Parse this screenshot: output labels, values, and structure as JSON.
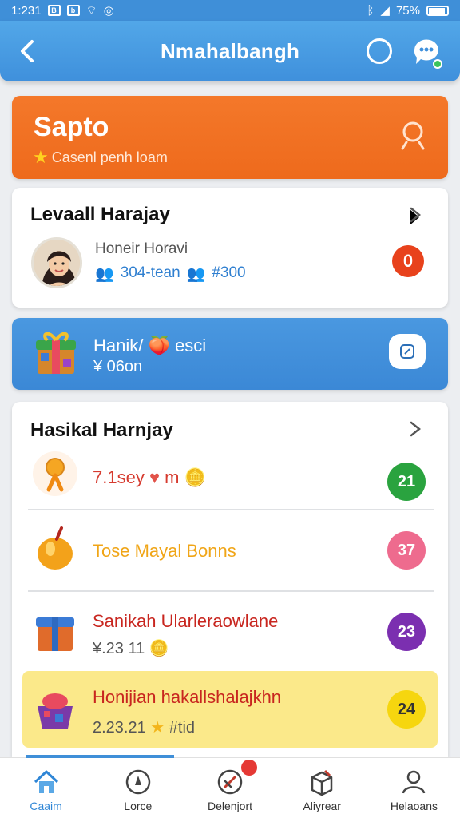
{
  "status": {
    "time": "1:231",
    "battery": "75%"
  },
  "appbar": {
    "title": "Nmahalbangh"
  },
  "hero": {
    "title": "Sapto",
    "subtitle": "Casenl penh loam"
  },
  "profile": {
    "heading": "Levaall Harajay",
    "name": "Honeir Horavi",
    "stat1": "304-tean",
    "stat2": "#300",
    "badge": "0"
  },
  "promo": {
    "line1": "Hanik/ 🍑 esci",
    "line2": "¥ 06on"
  },
  "list": {
    "heading": "Hasikal Harnjay",
    "items": [
      {
        "title": "7.1sey",
        "title2": "m",
        "badge": "21",
        "color": "#2aa33f"
      },
      {
        "title": "Tose Mayal Bonns",
        "badge": "37",
        "color": "#ee6b8e"
      },
      {
        "title": "Sanikah Ularleraowlane",
        "sub": "¥.23 11",
        "badge": "23",
        "color": "#7b2fb0"
      },
      {
        "title": "Honijian hakallshalajkhn",
        "sub": "2.23.21",
        "sub2": "#tid",
        "badge": "24",
        "color": "#f6d60f"
      }
    ]
  },
  "nav": [
    {
      "label": "Caaim"
    },
    {
      "label": "Lorce"
    },
    {
      "label": "Delenjort"
    },
    {
      "label": "Aliyrear"
    },
    {
      "label": "Helaoans"
    }
  ]
}
